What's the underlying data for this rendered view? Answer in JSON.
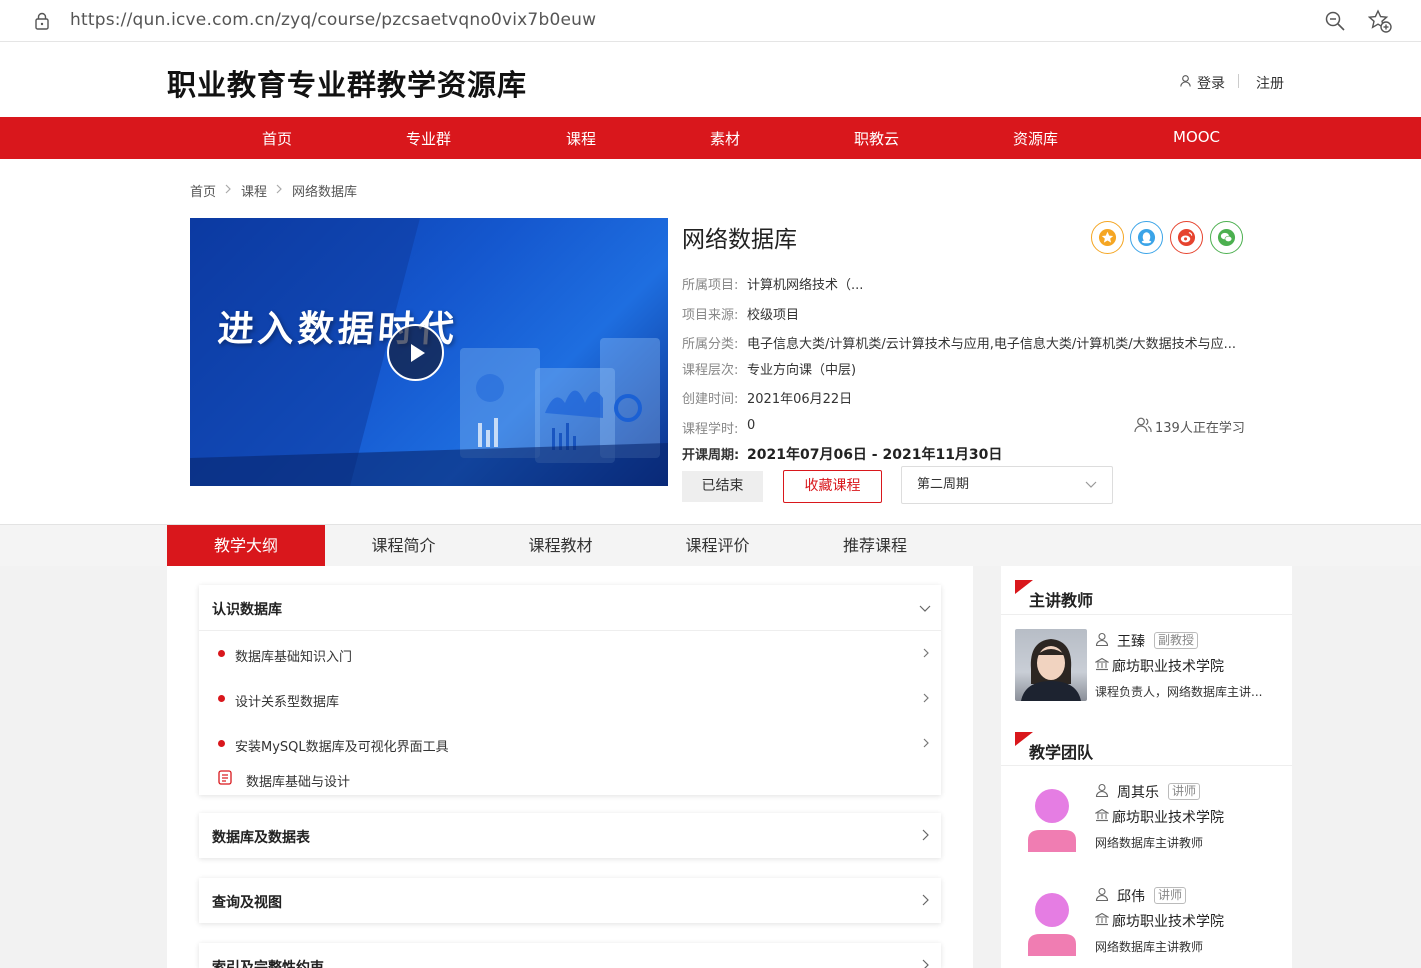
{
  "browser": {
    "url": "https://qun.icve.com.cn/zyq/course/pzcsaetvqno0vix7b0euw"
  },
  "header": {
    "site_title": "职业教育专业群教学资源库",
    "login": "登录",
    "register": "注册"
  },
  "nav": {
    "items": [
      "首页",
      "专业群",
      "课程",
      "素材",
      "职教云",
      "资源库",
      "MOOC"
    ]
  },
  "breadcrumb": [
    "首页",
    "课程",
    "网络数据库"
  ],
  "course": {
    "cover_text": "进入数据时代",
    "title": "网络数据库",
    "info": [
      {
        "label": "所属项目:",
        "value": "计算机网络技术（..."
      },
      {
        "label": "项目来源:",
        "value": "校级项目"
      },
      {
        "label": "所属分类:",
        "value": "电子信息大类/计算机类/云计算技术与应用,电子信息大类/计算机类/大数据技术与应..."
      },
      {
        "label": "课程层次:",
        "value": "专业方向课（中层)"
      },
      {
        "label": "创建时间:",
        "value": "2021年06月22日"
      },
      {
        "label": "课程学时:",
        "value": "0"
      }
    ],
    "period_label": "开课周期:",
    "period_value": "2021年07月06日 - 2021年11月30日",
    "learners": "139人正在学习",
    "status_button": "已结束",
    "favorite_button": "收藏课程",
    "week_select": "第二周期"
  },
  "tabs": [
    "教学大纲",
    "课程简介",
    "课程教材",
    "课程评价",
    "推荐课程"
  ],
  "syllabus": {
    "chapters": [
      {
        "title": "认识数据库",
        "lessons": [
          "数据库基础知识入门",
          "设计关系型数据库",
          "安装MySQL数据库及可视化界面工具"
        ],
        "doc": "数据库基础与设计"
      },
      {
        "title": "数据库及数据表"
      },
      {
        "title": "查询及视图"
      },
      {
        "title": "索引及完整性约束"
      }
    ]
  },
  "teachers": {
    "lead_title": "主讲教师",
    "lead": {
      "name": "王臻",
      "rank": "副教授",
      "school": "廊坊职业技术学院",
      "desc": "课程负责人，网络数据库主讲..."
    },
    "team_title": "教学团队",
    "team": [
      {
        "name": "周其乐",
        "rank": "讲师",
        "school": "廊坊职业技术学院",
        "desc": "网络数据库主讲教师"
      },
      {
        "name": "邱伟",
        "rank": "讲师",
        "school": "廊坊职业技术学院",
        "desc": "网络数据库主讲教师"
      }
    ]
  },
  "colors": {
    "accent": "#d9171c",
    "star": "#f5a623",
    "qq": "#3ba4e8",
    "weibo": "#e6432e",
    "wechat": "#4cb050"
  }
}
